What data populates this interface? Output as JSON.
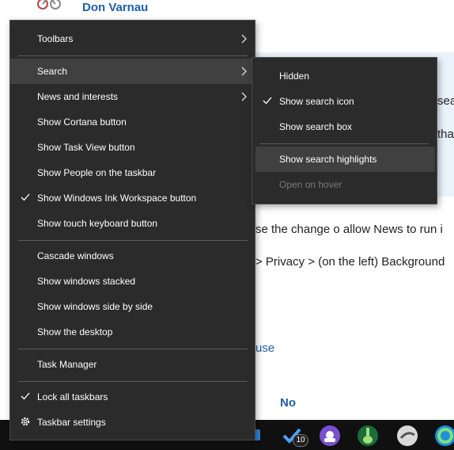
{
  "background": {
    "user_name": "Don Varnau",
    "fragment_sea": "sea",
    "fragment_tha": "tha",
    "line_change": "se the change o allow News to run i",
    "line_privacy": "> Privacy > (on the left) Background",
    "link_use": "use",
    "answer_no": "No"
  },
  "taskbar": {
    "badge_count": "10",
    "icons": [
      "store-icon",
      "todo-icon",
      "podcast-icon",
      "guitar-icon",
      "cloud-app-icon",
      "edge-icon"
    ]
  },
  "context_menu": {
    "items": [
      {
        "label": "Toolbars",
        "submenu": true
      },
      {
        "label": "Search",
        "submenu": true,
        "highlighted": true
      },
      {
        "label": "News and interests",
        "submenu": true
      },
      {
        "label": "Show Cortana button"
      },
      {
        "label": "Show Task View button"
      },
      {
        "label": "Show People on the taskbar"
      },
      {
        "label": "Show Windows Ink Workspace button",
        "checked": true
      },
      {
        "label": "Show touch keyboard button"
      },
      {
        "label": "Cascade windows"
      },
      {
        "label": "Show windows stacked"
      },
      {
        "label": "Show windows side by side"
      },
      {
        "label": "Show the desktop"
      },
      {
        "label": "Task Manager"
      },
      {
        "label": "Lock all taskbars",
        "checked": true
      },
      {
        "label": "Taskbar settings",
        "icon": "gear-icon"
      }
    ]
  },
  "search_submenu": {
    "items": [
      {
        "label": "Hidden"
      },
      {
        "label": "Show search icon",
        "checked": true
      },
      {
        "label": "Show search box"
      },
      {
        "label": "Show search highlights",
        "highlighted": true
      },
      {
        "label": "Open on hover",
        "disabled": true
      }
    ]
  },
  "colors": {
    "menu_bg": "#2b2b2b",
    "highlight": "#404040",
    "link": "#1f5fa8",
    "disabled_text": "#7a7a7a"
  }
}
